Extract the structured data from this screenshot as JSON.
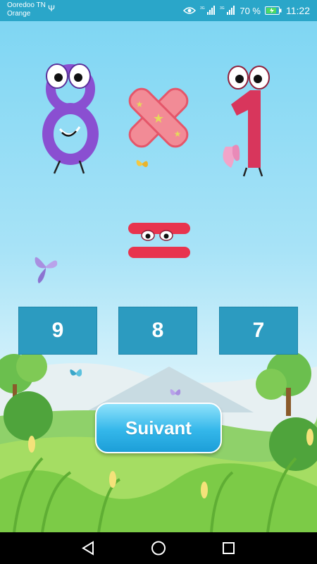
{
  "status_bar": {
    "carrier_1": "Ooredoo TN",
    "carrier_2": "Orange",
    "battery": "70 %",
    "time": "11:22"
  },
  "question": {
    "left_operand": "8",
    "operator": "multiply",
    "right_operand": "1"
  },
  "answers": [
    {
      "label": "9"
    },
    {
      "label": "8"
    },
    {
      "label": "7"
    }
  ],
  "next_button": {
    "label": "Suivant"
  },
  "colors": {
    "status_bar": "#2aa6c9",
    "answer_box": "#2c9bc0",
    "eight": "#8a4fd1",
    "one": "#d8365c",
    "multiply": "#e96372",
    "equals": "#e8344e"
  }
}
